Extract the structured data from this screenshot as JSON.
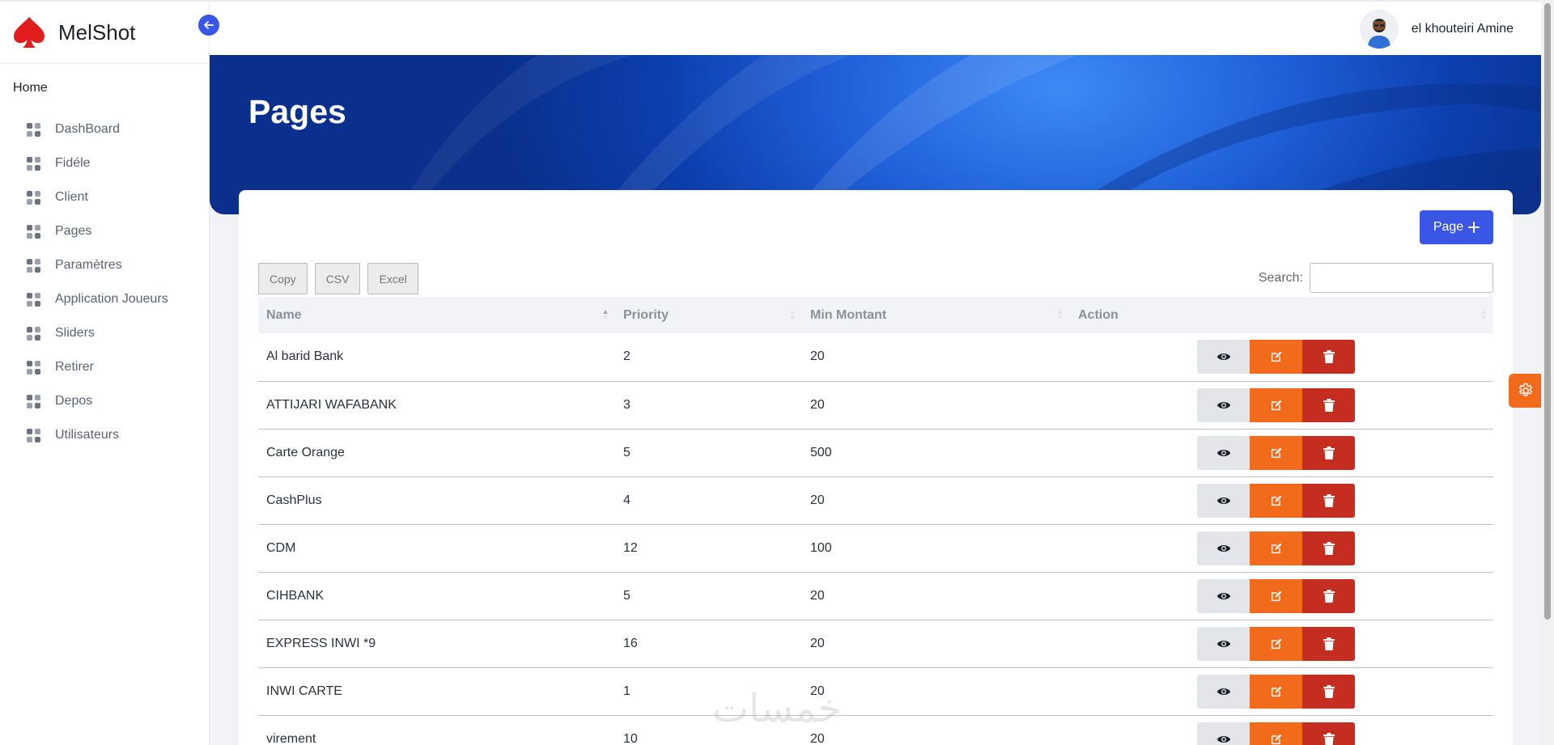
{
  "brand": {
    "name": "MelShot",
    "logo_icon": "spade-icon",
    "logo_color": "#e11d1d"
  },
  "sidebar": {
    "section": "Home",
    "items": [
      {
        "label": "DashBoard",
        "icon": "grid-icon"
      },
      {
        "label": "Fidéle",
        "icon": "grid-icon"
      },
      {
        "label": "Client",
        "icon": "grid-icon"
      },
      {
        "label": "Pages",
        "icon": "grid-icon"
      },
      {
        "label": "Paramètres",
        "icon": "grid-icon"
      },
      {
        "label": "Application Joueurs",
        "icon": "grid-icon"
      },
      {
        "label": "Sliders",
        "icon": "grid-icon"
      },
      {
        "label": "Retirer",
        "icon": "grid-icon"
      },
      {
        "label": "Depos",
        "icon": "grid-icon"
      },
      {
        "label": "Utilisateurs",
        "icon": "grid-icon"
      }
    ]
  },
  "header": {
    "user_name": "el khouteiri Amine"
  },
  "hero": {
    "title": "Pages"
  },
  "toolbar": {
    "add_label": "Page",
    "export": {
      "copy": "Copy",
      "csv": "CSV",
      "excel": "Excel"
    },
    "search_label": "Search:",
    "search_value": ""
  },
  "table": {
    "columns": {
      "name": "Name",
      "priority": "Priority",
      "min": "Min Montant",
      "action": "Action"
    },
    "rows": [
      {
        "name": "Al barid Bank",
        "priority": "2",
        "min": "20"
      },
      {
        "name": "ATTIJARI WAFABANK",
        "priority": "3",
        "min": "20"
      },
      {
        "name": "Carte Orange",
        "priority": "5",
        "min": "500"
      },
      {
        "name": "CashPlus",
        "priority": "4",
        "min": "20"
      },
      {
        "name": "CDM",
        "priority": "12",
        "min": "100"
      },
      {
        "name": "CIHBANK",
        "priority": "5",
        "min": "20"
      },
      {
        "name": "EXPRESS INWI *9",
        "priority": "16",
        "min": "20"
      },
      {
        "name": "INWI CARTE",
        "priority": "1",
        "min": "20"
      },
      {
        "name": "virement",
        "priority": "10",
        "min": "20"
      }
    ]
  },
  "colors": {
    "primary": "#3a56e4",
    "edit": "#f26a1b",
    "delete": "#c42d1f",
    "view": "#e4e5e8"
  },
  "watermark": {
    "text": "خمسات"
  }
}
